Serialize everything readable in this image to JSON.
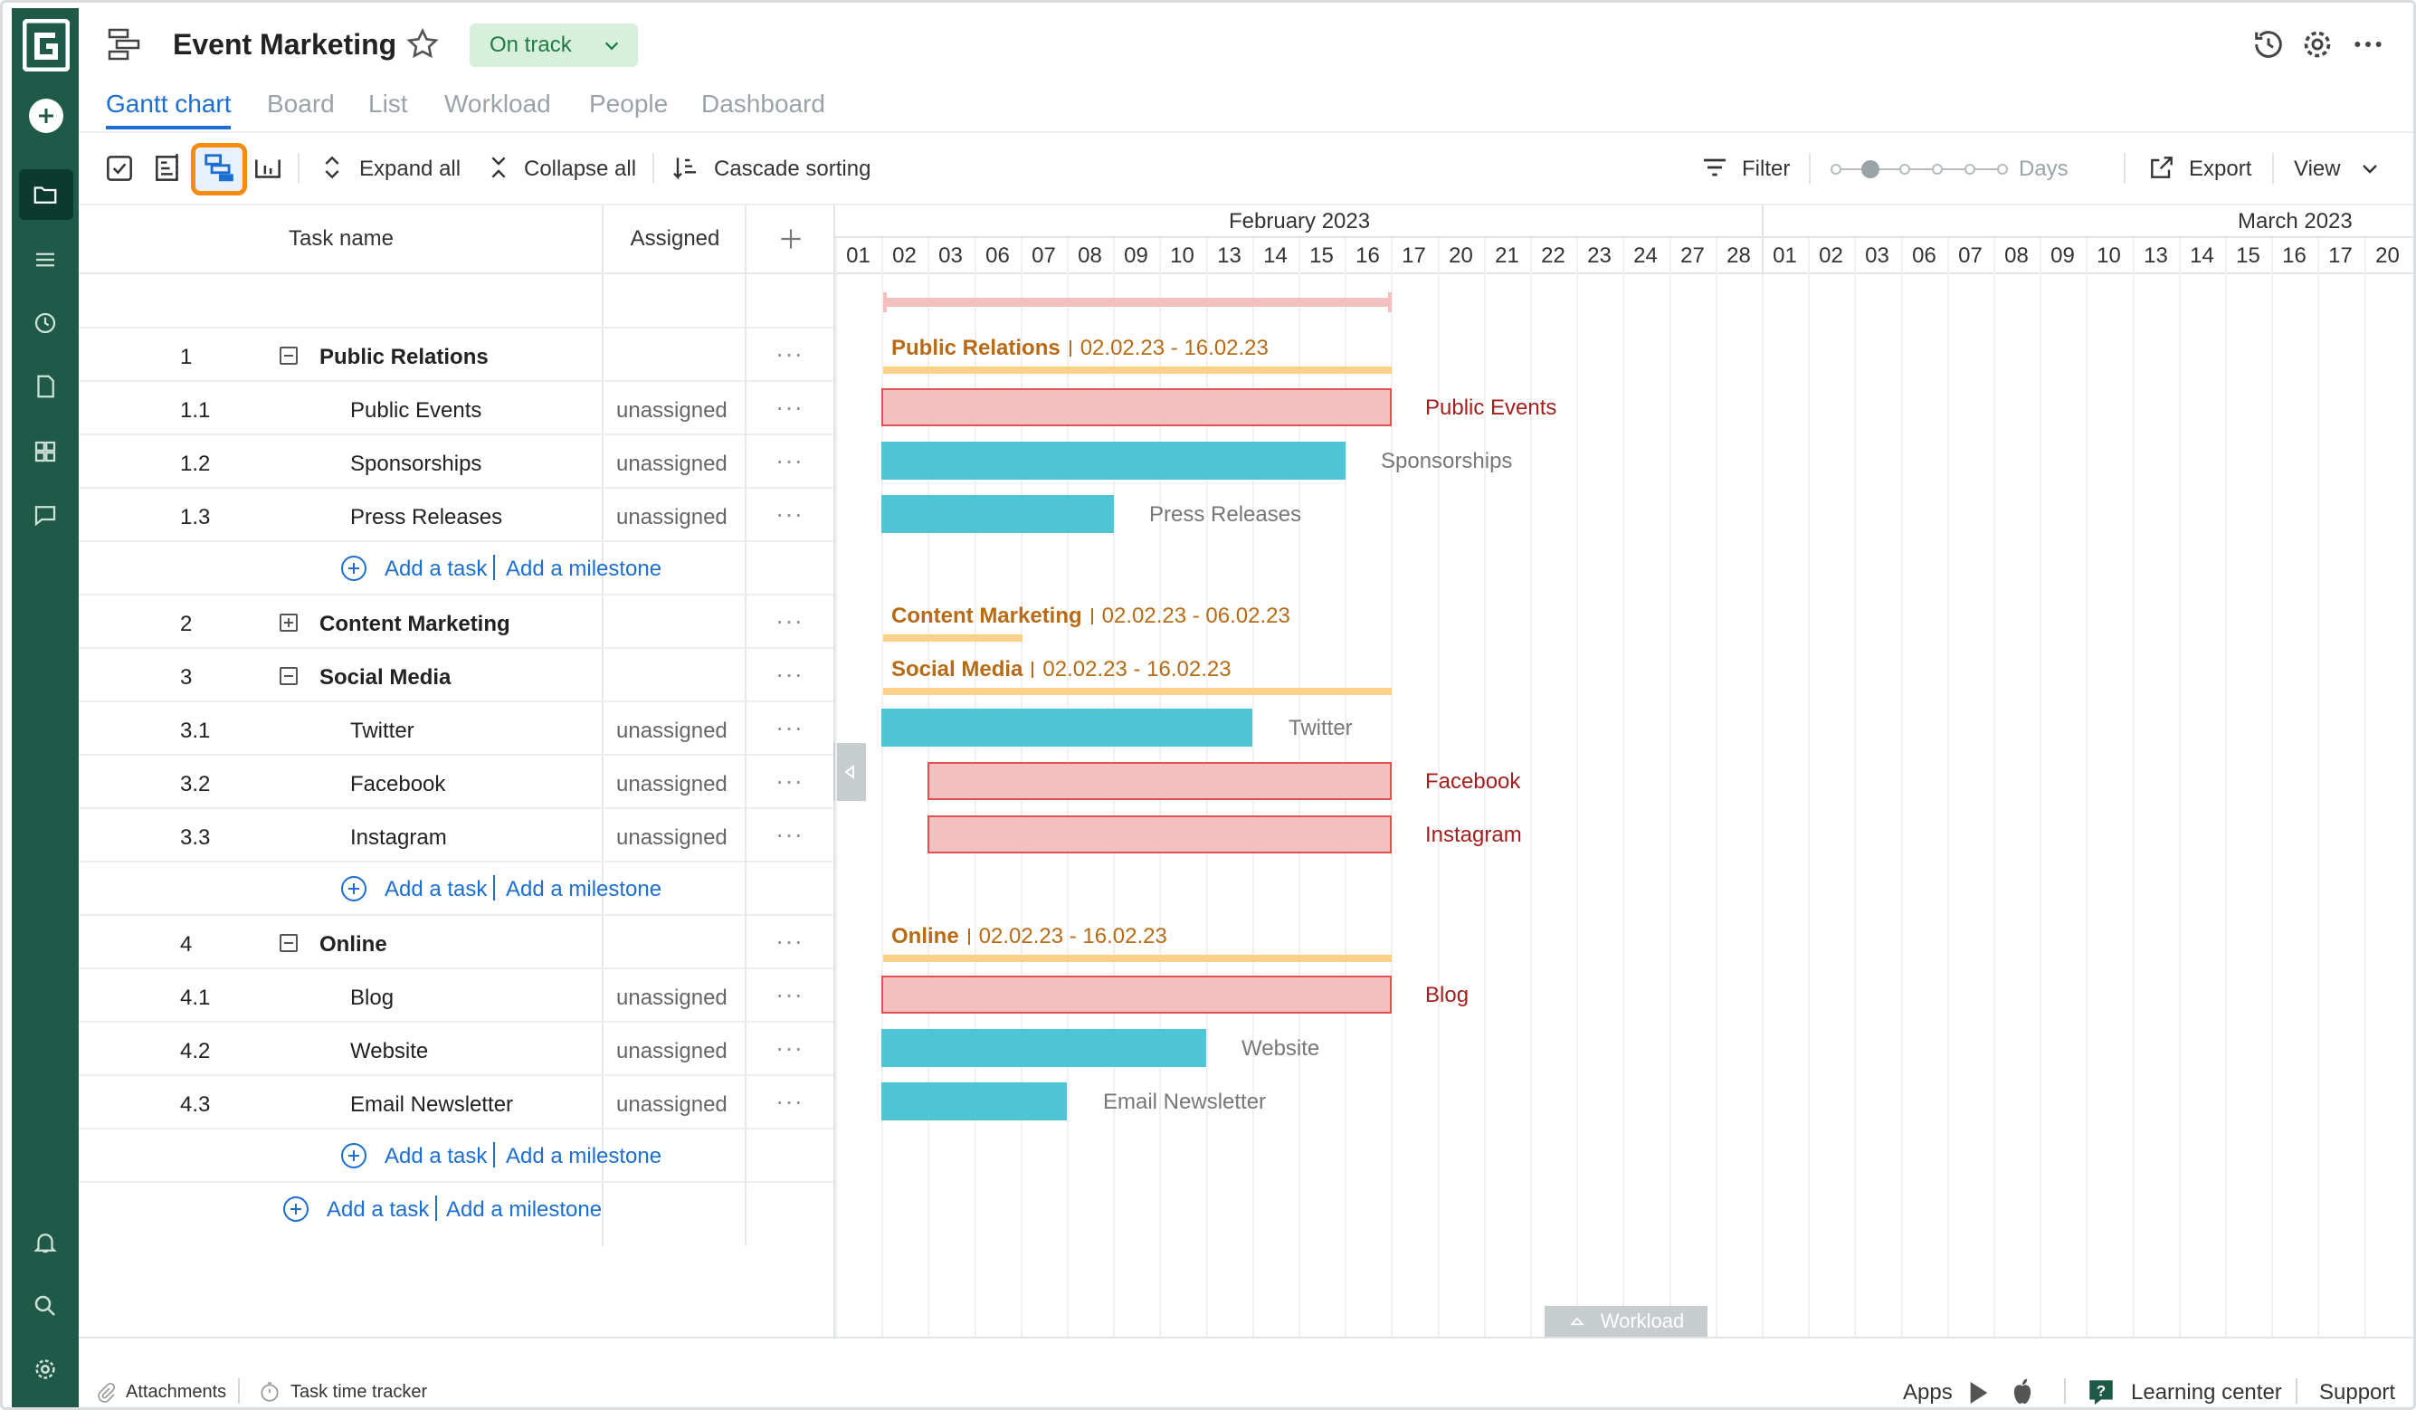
{
  "app": {
    "title": "Event Marketing",
    "status": "On track"
  },
  "tabs": [
    "Gantt chart",
    "Board",
    "List",
    "Workload",
    "People",
    "Dashboard"
  ],
  "toolbar": {
    "expand_all": "Expand all",
    "collapse_all": "Collapse all",
    "cascade_sorting": "Cascade sorting",
    "filter": "Filter",
    "zoom_level": "Days",
    "export": "Export",
    "view": "View"
  },
  "grid": {
    "col_task": "Task name",
    "col_assigned": "Assigned",
    "add_task": "Add a task",
    "add_milestone": "Add a milestone",
    "rows": [
      {
        "num": "1",
        "name": "Public Relations",
        "type": "group",
        "expanded": true,
        "assigned": ""
      },
      {
        "num": "1.1",
        "name": "Public Events",
        "type": "task",
        "assigned": "unassigned"
      },
      {
        "num": "1.2",
        "name": "Sponsorships",
        "type": "task",
        "assigned": "unassigned"
      },
      {
        "num": "1.3",
        "name": "Press Releases",
        "type": "task",
        "assigned": "unassigned"
      },
      {
        "num": "2",
        "name": "Content Marketing",
        "type": "group",
        "expanded": false,
        "assigned": ""
      },
      {
        "num": "3",
        "name": "Social Media",
        "type": "group",
        "expanded": true,
        "assigned": ""
      },
      {
        "num": "3.1",
        "name": "Twitter",
        "type": "task",
        "assigned": "unassigned"
      },
      {
        "num": "3.2",
        "name": "Facebook",
        "type": "task",
        "assigned": "unassigned"
      },
      {
        "num": "3.3",
        "name": "Instagram",
        "type": "task",
        "assigned": "unassigned"
      },
      {
        "num": "4",
        "name": "Online",
        "type": "group",
        "expanded": true,
        "assigned": ""
      },
      {
        "num": "4.1",
        "name": "Blog",
        "type": "task",
        "assigned": "unassigned"
      },
      {
        "num": "4.2",
        "name": "Website",
        "type": "task",
        "assigned": "unassigned"
      },
      {
        "num": "4.3",
        "name": "Email Newsletter",
        "type": "task",
        "assigned": "unassigned"
      }
    ]
  },
  "timeline": {
    "months": [
      "February 2023",
      "March 2023"
    ],
    "days": [
      "01",
      "02",
      "03",
      "06",
      "07",
      "08",
      "09",
      "10",
      "13",
      "14",
      "15",
      "16",
      "17",
      "20",
      "21",
      "22",
      "23",
      "24",
      "27",
      "28",
      "01",
      "02",
      "03",
      "06",
      "07",
      "08",
      "09",
      "10",
      "13",
      "14",
      "15",
      "16",
      "17",
      "20"
    ],
    "groups": [
      {
        "name": "Public Relations",
        "dates": "02.02.23 - 16.02.23"
      },
      {
        "name": "Content Marketing",
        "dates": "02.02.23 - 06.02.23"
      },
      {
        "name": "Social Media",
        "dates": "02.02.23 - 16.02.23"
      },
      {
        "name": "Online",
        "dates": "02.02.23 - 16.02.23"
      }
    ],
    "bars": [
      {
        "label": "Public Events",
        "color": "pink"
      },
      {
        "label": "Sponsorships",
        "color": "teal"
      },
      {
        "label": "Press Releases",
        "color": "teal"
      },
      {
        "label": "Twitter",
        "color": "teal"
      },
      {
        "label": "Facebook",
        "color": "pink"
      },
      {
        "label": "Instagram",
        "color": "pink"
      },
      {
        "label": "Blog",
        "color": "pink"
      },
      {
        "label": "Website",
        "color": "teal"
      },
      {
        "label": "Email Newsletter",
        "color": "teal"
      }
    ],
    "workload_label": "Workload"
  },
  "footer": {
    "attachments": "Attachments",
    "time_tracker": "Task time tracker",
    "apps": "Apps",
    "learning_center": "Learning center",
    "support": "Support"
  },
  "colors": {
    "rail": "#1f5a49",
    "accent": "#1c6fd1",
    "task_bar_teal": "#4fc4d4",
    "task_bar_pink": "#f4c0bf",
    "group_bar": "#fcd088",
    "selected_outline": "#f58b0f"
  }
}
